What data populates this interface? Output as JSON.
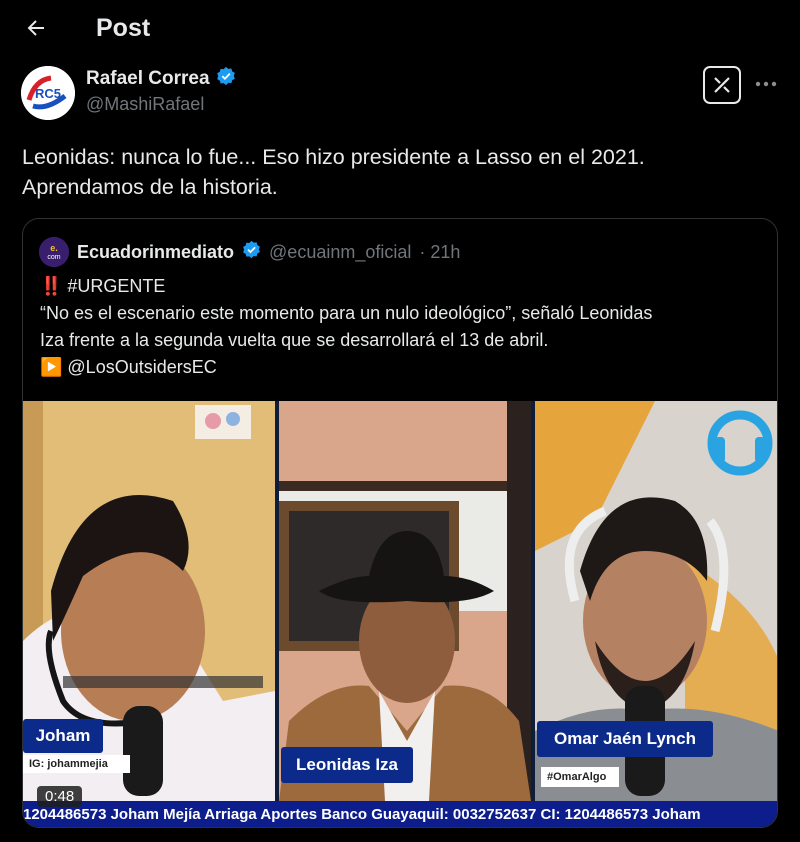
{
  "header": {
    "title": "Post"
  },
  "author": {
    "name": "Rafael Correa",
    "handle": "@MashiRafael",
    "avatar_text": "RC5"
  },
  "post": {
    "lines": [
      "Leonidas: nunca lo fue... Eso hizo presidente a Lasso en el 2021.",
      "Aprendamos de la historia."
    ]
  },
  "quote": {
    "name": "Ecuadorinmediato",
    "handle": "@ecuainm_oficial",
    "time": "· 21h",
    "avatar_text": "e.com",
    "lines": [
      "‼️ #URGENTE",
      "“No es el escenario este momento para un nulo ideológico”, señaló Leonidas",
      "Iza frente a la segunda vuelta que se desarrollará el 13 de abril.",
      "▶️ @LosOutsidersEC"
    ]
  },
  "video": {
    "duration": "0:48",
    "panels": [
      {
        "name": "Joham",
        "sub": "IG: johammejia"
      },
      {
        "name": "Leonidas Iza"
      },
      {
        "name": "Omar Jaén Lynch",
        "sub": "#OmarAlgo"
      }
    ],
    "ticker": "1204486573 Joham Mejía Arriaga Aportes Banco Guayaquil: 0032752637 CI: 1204486573 Joham"
  },
  "colors": {
    "verified": "#1d9bf0",
    "muted": "#71767b",
    "tag": "#0c2a8a"
  }
}
